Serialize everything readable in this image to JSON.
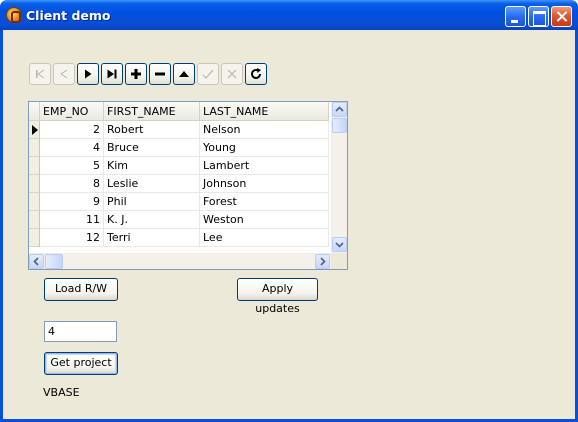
{
  "window": {
    "title": "Client demo"
  },
  "navigator": {
    "buttons": [
      {
        "name": "first-record-icon",
        "enabled": false
      },
      {
        "name": "prior-record-icon",
        "enabled": false
      },
      {
        "name": "next-record-icon",
        "enabled": true
      },
      {
        "name": "last-record-icon",
        "enabled": true
      },
      {
        "name": "insert-record-icon",
        "enabled": true
      },
      {
        "name": "delete-record-icon",
        "enabled": true
      },
      {
        "name": "edit-record-icon",
        "enabled": true
      },
      {
        "name": "post-edit-icon",
        "enabled": false
      },
      {
        "name": "cancel-edit-icon",
        "enabled": false
      },
      {
        "name": "refresh-data-icon",
        "enabled": true
      }
    ]
  },
  "grid": {
    "columns": [
      "EMP_NO",
      "FIRST_NAME",
      "LAST_NAME"
    ],
    "current_row": 0,
    "rows": [
      {
        "emp_no": "2",
        "first_name": "Robert",
        "last_name": "Nelson"
      },
      {
        "emp_no": "4",
        "first_name": "Bruce",
        "last_name": "Young"
      },
      {
        "emp_no": "5",
        "first_name": "Kim",
        "last_name": "Lambert"
      },
      {
        "emp_no": "8",
        "first_name": "Leslie",
        "last_name": "Johnson"
      },
      {
        "emp_no": "9",
        "first_name": "Phil",
        "last_name": "Forest"
      },
      {
        "emp_no": "11",
        "first_name": "K. J.",
        "last_name": "Weston"
      },
      {
        "emp_no": "12",
        "first_name": "Terri",
        "last_name": "Lee"
      }
    ]
  },
  "buttons": {
    "load_rw": "Load R/W",
    "apply_updates": "Apply updates",
    "get_project": "Get project"
  },
  "project_input": {
    "value": "4"
  },
  "result_label": "VBASE"
}
